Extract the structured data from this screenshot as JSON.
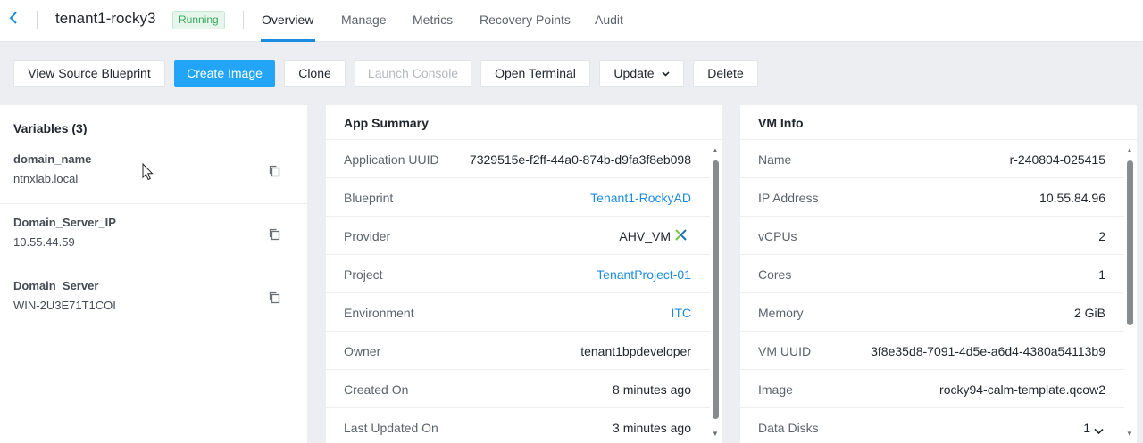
{
  "header": {
    "title": "tenant1-rocky3",
    "status": "Running",
    "tabs": [
      "Overview",
      "Manage",
      "Metrics",
      "Recovery Points",
      "Audit"
    ]
  },
  "toolbar": {
    "view_source_blueprint": "View Source Blueprint",
    "create_image": "Create Image",
    "clone": "Clone",
    "launch_console": "Launch Console",
    "open_terminal": "Open Terminal",
    "update": "Update",
    "delete": "Delete"
  },
  "variables": {
    "title": "Variables (3)",
    "items": [
      {
        "name": "domain_name",
        "value": "ntnxlab.local"
      },
      {
        "name": "Domain_Server_IP",
        "value": "10.55.44.59"
      },
      {
        "name": "Domain_Server",
        "value": "WIN-2U3E71T1COI"
      }
    ]
  },
  "app_summary": {
    "title": "App Summary",
    "rows": [
      {
        "label": "Application UUID",
        "value": "7329515e-f2ff-44a0-874b-d9fa3f8eb098"
      },
      {
        "label": "Blueprint",
        "value": "Tenant1-RockyAD"
      },
      {
        "label": "Provider",
        "value": "AHV_VM"
      },
      {
        "label": "Project",
        "value": "TenantProject-01"
      },
      {
        "label": "Environment",
        "value": "ITC"
      },
      {
        "label": "Owner",
        "value": "tenant1bpdeveloper"
      },
      {
        "label": "Created On",
        "value": "8 minutes ago"
      },
      {
        "label": "Last Updated On",
        "value": "3 minutes ago"
      }
    ]
  },
  "vm_info": {
    "title": "VM Info",
    "rows": [
      {
        "label": "Name",
        "value": "r-240804-025415"
      },
      {
        "label": "IP Address",
        "value": "10.55.84.96"
      },
      {
        "label": "vCPUs",
        "value": "2"
      },
      {
        "label": "Cores",
        "value": "1"
      },
      {
        "label": "Memory",
        "value": "2 GiB"
      },
      {
        "label": "VM UUID",
        "value": "3f8e35d8-7091-4d5e-a6d4-4380a54113b9"
      },
      {
        "label": "Image",
        "value": "rocky94-calm-template.qcow2"
      },
      {
        "label": "Data Disks",
        "value": "1"
      }
    ]
  },
  "colors": {
    "accent": "#1b8be0",
    "primary_button": "#22a5f7",
    "status_running": "#36a85a",
    "nutanix_green": "#7cc242",
    "nutanix_blue": "#1d6fb8"
  }
}
